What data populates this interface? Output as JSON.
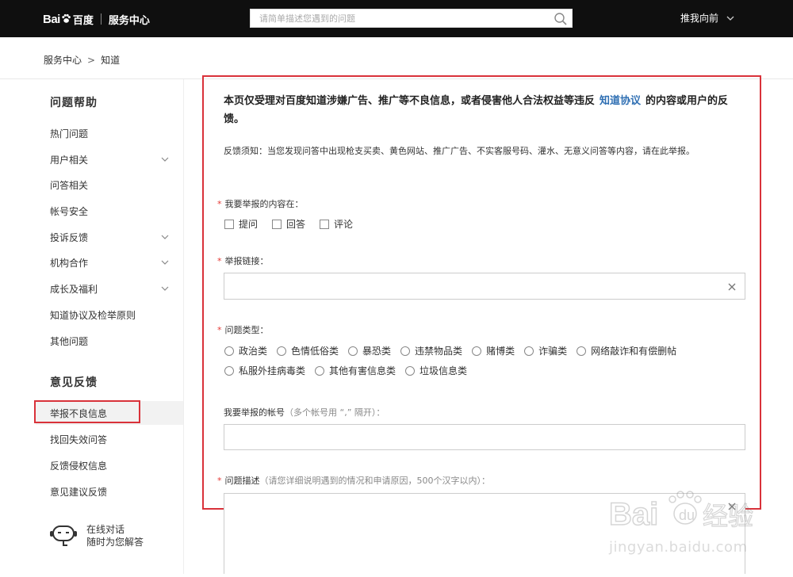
{
  "header": {
    "logo_bai": "Bai",
    "logo_du": "百度",
    "service_label": "服务中心",
    "search_placeholder": "请简单描述您遇到的问题",
    "username": "推我向前"
  },
  "breadcrumb": {
    "home": "服务中心",
    "current": "知道"
  },
  "sidebar": {
    "section1_title": "问题帮助",
    "items": [
      {
        "label": "热门问题",
        "has_arrow": false
      },
      {
        "label": "用户相关",
        "has_arrow": true
      },
      {
        "label": "问答相关",
        "has_arrow": false
      },
      {
        "label": "帐号安全",
        "has_arrow": false
      },
      {
        "label": "投诉反馈",
        "has_arrow": true
      },
      {
        "label": "机构合作",
        "has_arrow": true
      },
      {
        "label": "成长及福利",
        "has_arrow": true
      },
      {
        "label": "知道协议及检举原则",
        "has_arrow": false
      },
      {
        "label": "其他问题",
        "has_arrow": false
      }
    ],
    "section2_title": "意见反馈",
    "feedback_items": [
      {
        "label": "举报不良信息",
        "active": true
      },
      {
        "label": "找回失效问答",
        "active": false
      },
      {
        "label": "反馈侵权信息",
        "active": false
      },
      {
        "label": "意见建议反馈",
        "active": false
      }
    ],
    "help_line1": "在线对话",
    "help_line2": "随时为您解答"
  },
  "main": {
    "title_part1": "本页仅受理对百度知道涉嫌广告、推广等不良信息，或者侵害他人合法权益等违反",
    "title_link": "知道协议",
    "title_part2": "的内容或用户的反馈。",
    "notice": "反馈须知：当您发现问答中出现枪支买卖、黄色网站、推广广告、不实客服号码、灌水、无意义问答等内容，请在此举报。",
    "required_mark": "*",
    "content_label": "我要举报的内容在：",
    "content_options": [
      "提问",
      "回答",
      "评论"
    ],
    "link_label": "举报链接：",
    "type_label": "问题类型：",
    "type_options_row1": [
      "政治类",
      "色情低俗类",
      "暴恐类",
      "违禁物品类",
      "赌博类",
      "诈骗类",
      "网络敲诈和有偿删帖"
    ],
    "type_options_row2": [
      "私服外挂病毒类",
      "其他有害信息类",
      "垃圾信息类"
    ],
    "account_label": "我要举报的帐号",
    "account_hint": "（多个帐号用 “,” 隔开）：",
    "desc_label": "问题描述",
    "desc_hint": "（请您详细说明遇到的情况和申请原因，500个汉字以内）："
  },
  "watermark": {
    "brand": "Bai du 经验",
    "url": "jingyan.baidu.com"
  },
  "colors": {
    "header_bg": "#0f0f0f",
    "highlight_red": "#d9323a",
    "link_blue": "#2f6fb3",
    "required_red": "#e53935"
  }
}
